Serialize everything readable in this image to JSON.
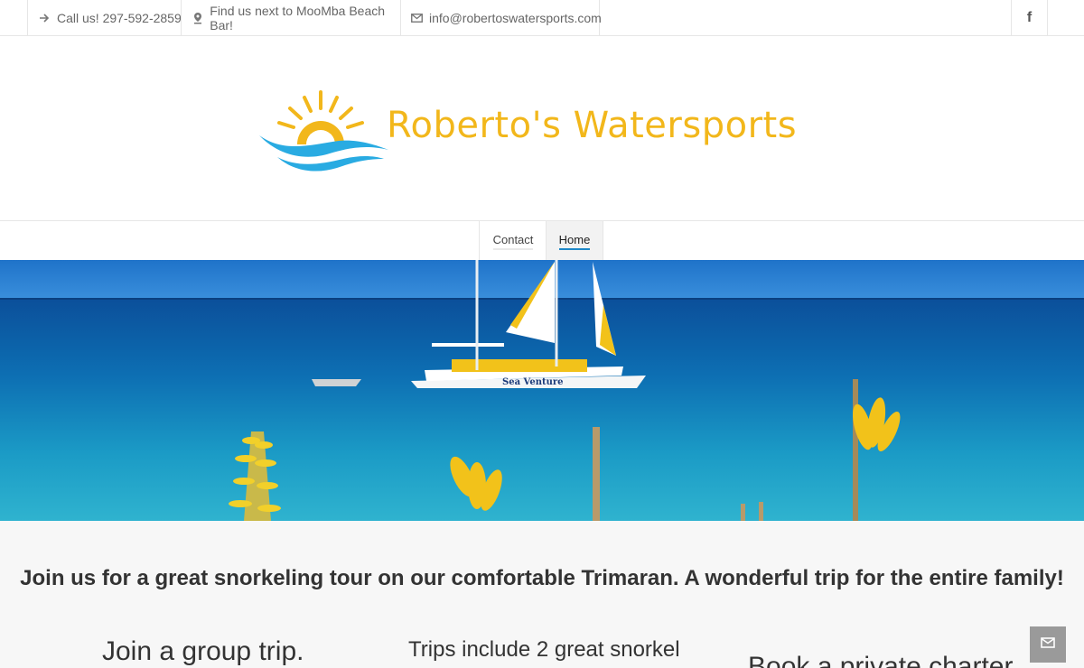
{
  "topbar": {
    "phone": "Call us! 297-592-2859",
    "location": "Find us next to MooMba Beach Bar!",
    "email": "info@robertoswatersports.com",
    "social_icon": "facebook-icon"
  },
  "logo": {
    "text": "Roberto's Watersports",
    "color": "#f2b71b",
    "wave_color": "#29abe2"
  },
  "nav": {
    "items": [
      {
        "label": "Contact"
      },
      {
        "label": "Home"
      }
    ],
    "active": "Home",
    "accent": "#1e88c8"
  },
  "hero": {
    "boat_name": "Sea Venture"
  },
  "content": {
    "tagline": "Join us for a great snorkeling tour on our comfortable Trimaran. A wonderful trip for the entire family!",
    "col1_heading": "Join a group trip.",
    "col2_text": "Trips include 2 great snorkel",
    "col3_heading": "Book a private charter"
  },
  "contact_button_icon": "envelope-icon"
}
